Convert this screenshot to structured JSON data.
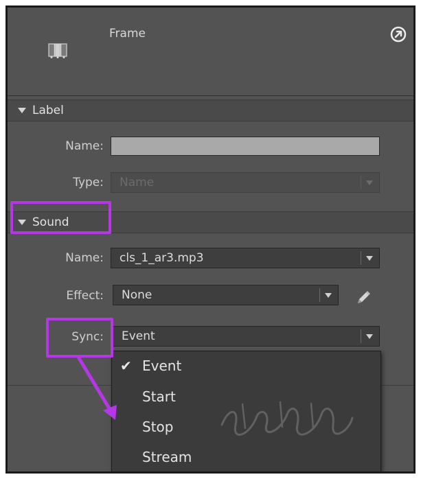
{
  "header": {
    "title": "Frame",
    "frame_icon": "frame-icon",
    "help_icon": "help-circle-arrow-icon"
  },
  "label_section": {
    "title": "Label",
    "name_label": "Name:",
    "name_value": "",
    "type_label": "Type:",
    "type_value": "Name"
  },
  "sound_section": {
    "title": "Sound",
    "name_label": "Name:",
    "name_value": "cls_1_ar3.mp3",
    "effect_label": "Effect:",
    "effect_value": "None",
    "edit_icon": "pencil-icon",
    "sync_label": "Sync:",
    "sync_value": "Event"
  },
  "sync_dropdown": {
    "options": [
      "Event",
      "Start",
      "Stop",
      "Stream"
    ],
    "selected": "Event",
    "check_glyph": "✔"
  },
  "colors": {
    "panel_bg": "#535353",
    "highlight": "#b537e6"
  }
}
